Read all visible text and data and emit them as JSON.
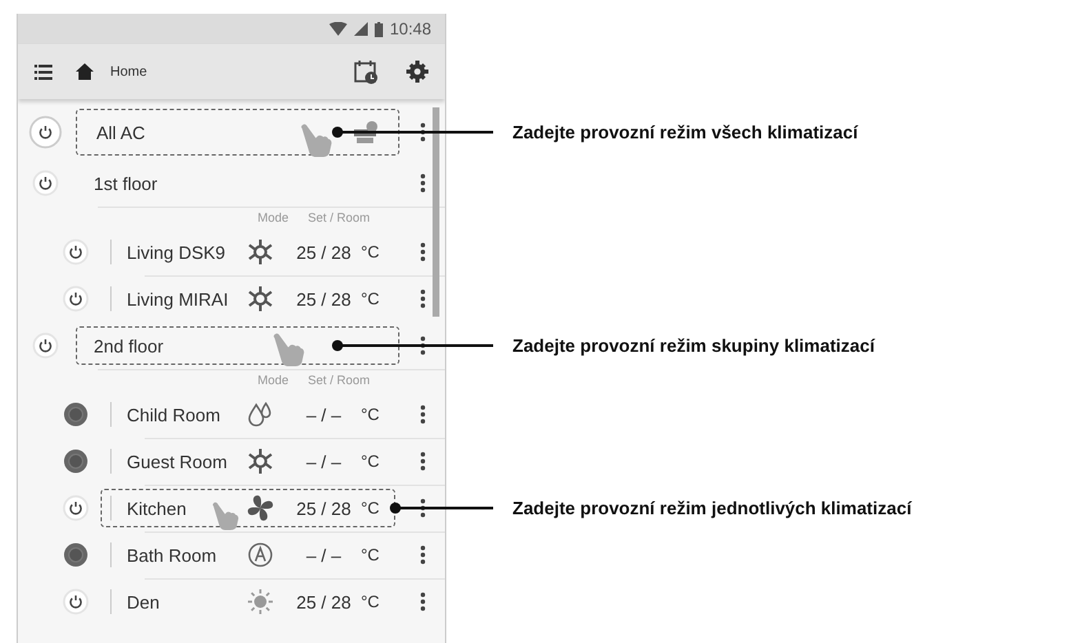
{
  "status_bar": {
    "time": "10:48"
  },
  "app_bar": {
    "title": "Home"
  },
  "items": [
    {
      "kind": "all",
      "name": "All AC",
      "on": true,
      "highlighted": true
    },
    {
      "kind": "group",
      "name": "1st floor",
      "on": true,
      "highlighted": false,
      "columns": [
        "Mode",
        "Set / Room"
      ],
      "children": [
        {
          "name": "Living DSK9",
          "on": true,
          "kind": "cool",
          "temp": "25 / 28",
          "unit": "°C",
          "highlighted": false
        },
        {
          "name": "Living MIRAI",
          "on": true,
          "kind": "cool",
          "temp": "25 / 28",
          "unit": "°C",
          "highlighted": false
        }
      ]
    },
    {
      "kind": "group",
      "name": "2nd floor",
      "on": true,
      "highlighted": true,
      "columns": [
        "Mode",
        "Set / Room"
      ],
      "children": [
        {
          "name": "Child Room",
          "on": false,
          "kind": "dry",
          "temp": "– / –",
          "unit": "°C",
          "highlighted": false
        },
        {
          "name": "Guest Room",
          "on": false,
          "kind": "cool",
          "temp": "– / –",
          "unit": "°C",
          "highlighted": false
        },
        {
          "name": "Kitchen",
          "on": true,
          "kind": "fan",
          "temp": "25 / 28",
          "unit": "°C",
          "highlighted": true
        },
        {
          "name": "Bath Room",
          "on": false,
          "kind": "auto",
          "temp": "– / –",
          "unit": "°C",
          "highlighted": false
        },
        {
          "name": "Den",
          "on": true,
          "kind": "heat",
          "temp": "25 / 28",
          "unit": "°C",
          "highlighted": false
        }
      ]
    }
  ],
  "callouts": [
    {
      "text": "Zadejte provozní režim všech klimatizací"
    },
    {
      "text": "Zadejte provozní režim skupiny klimatizací"
    },
    {
      "text": "Zadejte provozní režim jednotlivých klimatizací"
    }
  ]
}
